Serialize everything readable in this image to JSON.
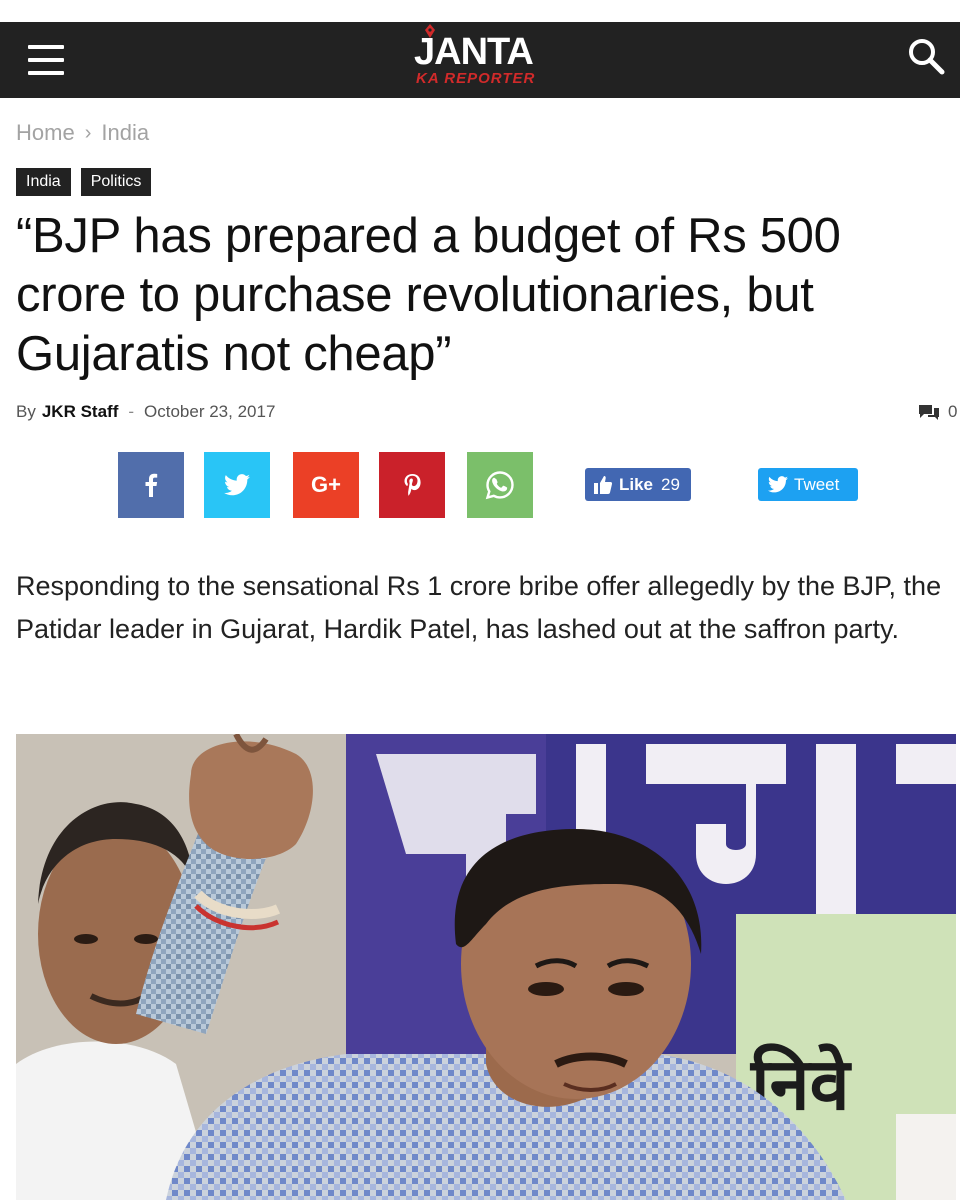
{
  "site": {
    "logo_main": "JANTA",
    "logo_sub": "KA REPORTER"
  },
  "breadcrumb": {
    "items": [
      "Home",
      "India"
    ],
    "separator": "›"
  },
  "tags": [
    "India",
    "Politics"
  ],
  "article": {
    "title": "“BJP has prepared a budget of Rs 500 crore to purchase revolutionaries, but Gujaratis not cheap”",
    "by_label": "By",
    "author": "JKR Staff",
    "date_separator": "-",
    "date": "October 23, 2017",
    "comment_count": "0",
    "lead": "Responding to the sensational Rs 1 crore bribe offer allegedly by the BJP, the Patidar leader in Gujarat, Hardik Patel, has lashed out at the saffron party."
  },
  "share": {
    "facebook_icon": "facebook-icon",
    "twitter_icon": "twitter-icon",
    "googleplus_label": "G+",
    "pinterest_icon": "pinterest-icon",
    "whatsapp_icon": "whatsapp-icon",
    "like_label": "Like",
    "like_count": "29",
    "tweet_label": "Tweet"
  },
  "colors": {
    "header_bg": "#222222",
    "logo_red": "#d12a2a",
    "facebook": "#516eab",
    "twitter": "#29c5f6",
    "googleplus": "#eb4026",
    "pinterest": "#ca212a",
    "whatsapp": "#7bbf6a",
    "fb_like": "#4267b2",
    "tweet": "#1da1f2"
  },
  "image": {
    "banner_text_partial": "निवे"
  }
}
